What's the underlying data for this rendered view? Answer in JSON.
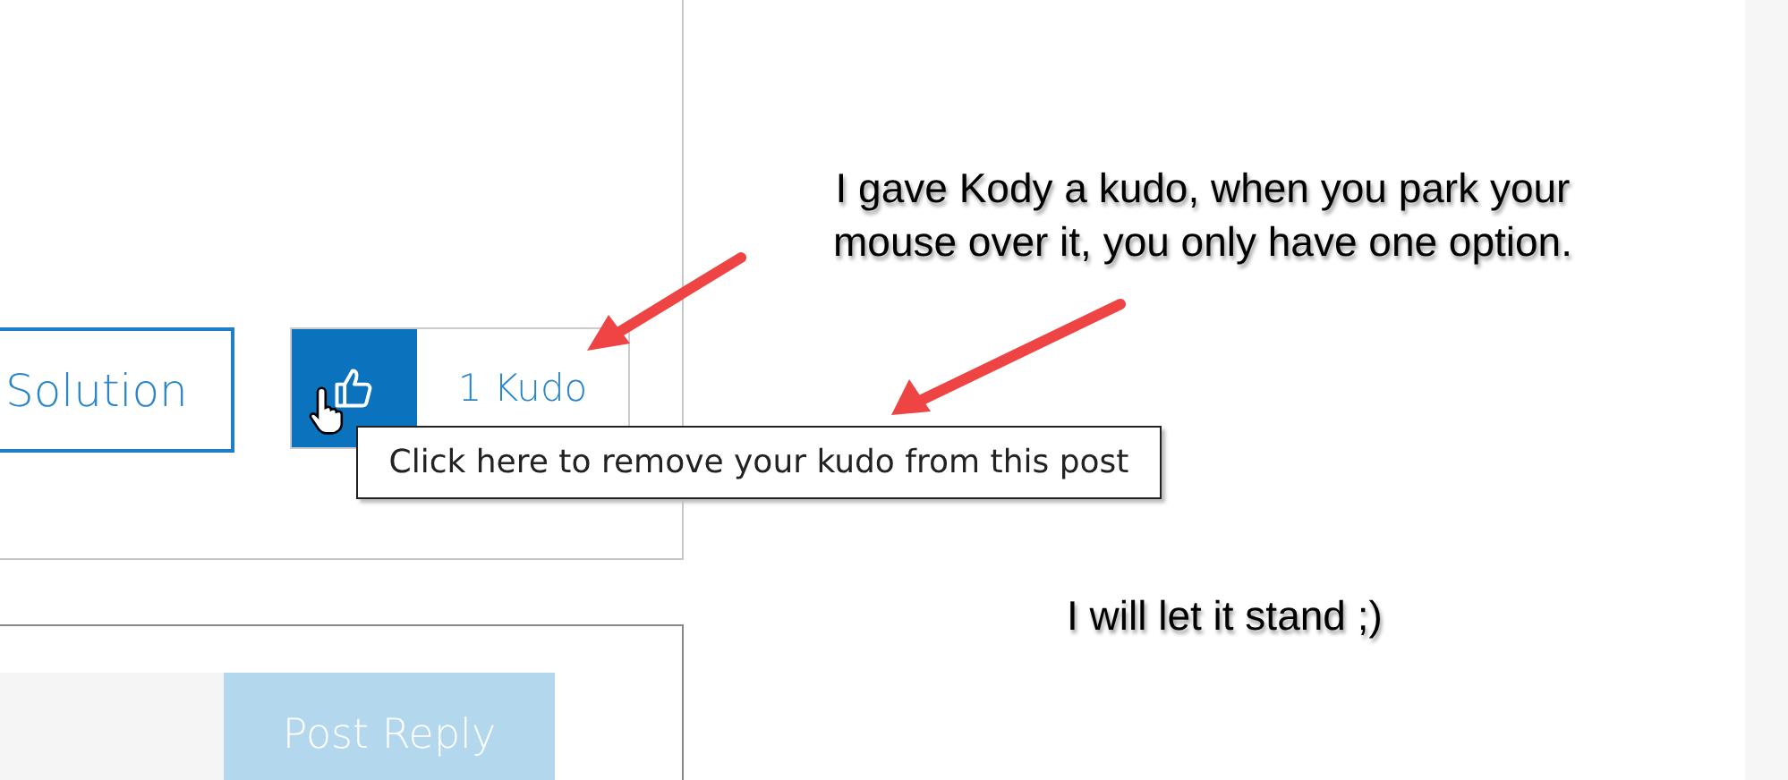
{
  "post": {
    "solution_button": {
      "label": "Solution"
    },
    "kudo_button": {
      "label": "1 Kudo",
      "given": true
    },
    "tooltip": "Click here to remove your kudo from this post"
  },
  "reply": {
    "post_reply_button": {
      "label": "Post Reply",
      "disabled": true
    }
  },
  "annotations": [
    {
      "text": "I gave Kody a kudo, when you park your mouse over it, you only have one option."
    },
    {
      "text": "I will let it stand ;)"
    }
  ]
}
